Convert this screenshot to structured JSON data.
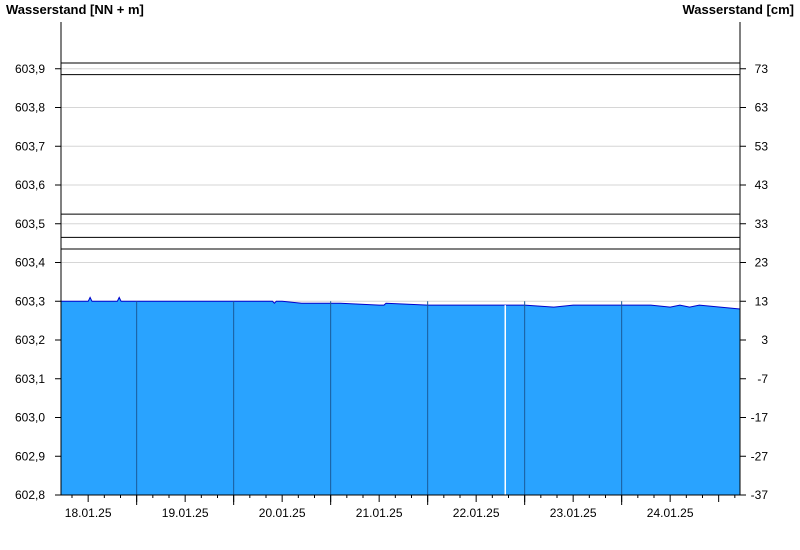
{
  "chart_data": {
    "type": "area",
    "title": "",
    "ylabel_left": "Wasserstand [NN + m]",
    "ylabel_right": "Wasserstand [cm]",
    "x_tick_labels": [
      "18.01.25",
      "19.01.25",
      "20.01.25",
      "21.01.25",
      "22.01.25",
      "23.01.25",
      "24.01.25"
    ],
    "day_boundaries": [
      "18.01.25 12:00",
      "19.01.25 12:00",
      "20.01.25 12:00",
      "21.01.25 12:00",
      "22.01.25 12:00",
      "23.01.25 12:00"
    ],
    "x_range_days": [
      17.72,
      24.72
    ],
    "ylim_left": [
      602.8,
      604.0
    ],
    "yticks_left": [
      "602,8",
      "602,9",
      "603,0",
      "603,1",
      "603,2",
      "603,3",
      "603,4",
      "603,5",
      "603,6",
      "603,7",
      "603,8",
      "603,9"
    ],
    "yticks_left_values": [
      602.8,
      602.9,
      603.0,
      603.1,
      603.2,
      603.3,
      603.4,
      603.5,
      603.6,
      603.7,
      603.8,
      603.9
    ],
    "yticks_right": [
      "-37",
      "-27",
      "-17",
      "-7",
      "3",
      "13",
      "23",
      "33",
      "43",
      "53",
      "63",
      "73"
    ],
    "reference_lines": [
      603.915,
      603.885,
      603.525,
      603.465,
      603.435
    ],
    "grid": true,
    "series": [
      {
        "color": "#29a3ff",
        "line_color": "#0000cc",
        "x_days": [
          17.72,
          18.0,
          18.02,
          18.04,
          18.3,
          18.32,
          18.34,
          19.0,
          19.5,
          19.9,
          19.92,
          19.94,
          20.0,
          20.2,
          20.6,
          21.0,
          21.05,
          21.07,
          21.5,
          22.0,
          22.3,
          22.35,
          22.5,
          22.8,
          23.0,
          23.3,
          23.8,
          24.0,
          24.1,
          24.2,
          24.3,
          24.72
        ],
        "values": [
          603.3,
          603.3,
          603.31,
          603.3,
          603.3,
          603.31,
          603.3,
          603.3,
          603.3,
          603.3,
          603.295,
          603.3,
          603.3,
          603.295,
          603.295,
          603.29,
          603.29,
          603.295,
          603.29,
          603.29,
          603.29,
          603.29,
          603.29,
          603.285,
          603.29,
          603.29,
          603.29,
          603.285,
          603.29,
          603.285,
          603.29,
          603.28
        ]
      }
    ]
  }
}
